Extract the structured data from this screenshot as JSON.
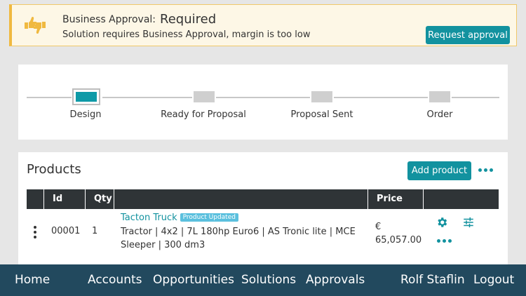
{
  "banner": {
    "label": "Business Approval:",
    "status": "Required",
    "message": "Solution requires Business Approval, margin is too low",
    "button": "Request approval",
    "icon": "thumbs-up-down-icon"
  },
  "stepper": {
    "steps": [
      {
        "label": "Design",
        "active": true
      },
      {
        "label": "Ready for Proposal",
        "active": false
      },
      {
        "label": "Proposal Sent",
        "active": false
      },
      {
        "label": "Order",
        "active": false
      }
    ]
  },
  "products": {
    "title": "Products",
    "add_button": "Add product",
    "columns": [
      "",
      "Id",
      "Qty",
      "",
      "Price",
      ""
    ],
    "rows": [
      {
        "id": "00001",
        "qty": "1",
        "name": "Tacton Truck",
        "badge": "Product Updated",
        "desc_line1": "Tractor | 4x2 | 7L 180hp Euro6 | AS Tronic lite | MCE",
        "desc_line2": "Sleeper | 300 dm3",
        "currency": "€",
        "price": "65,057.00"
      }
    ]
  },
  "nav": {
    "home": "Home",
    "accounts": "Accounts",
    "opportunities": "Opportunities",
    "solutions": "Solutions",
    "approvals": "Approvals",
    "user": "Rolf Staflin",
    "logout": "Logout"
  },
  "colors": {
    "accent": "#12929f",
    "banner_bg": "#fdf7e6",
    "banner_border": "#f0b940",
    "nav_bg": "#22495e",
    "table_header": "#2f3437",
    "badge": "#5bc0de"
  }
}
